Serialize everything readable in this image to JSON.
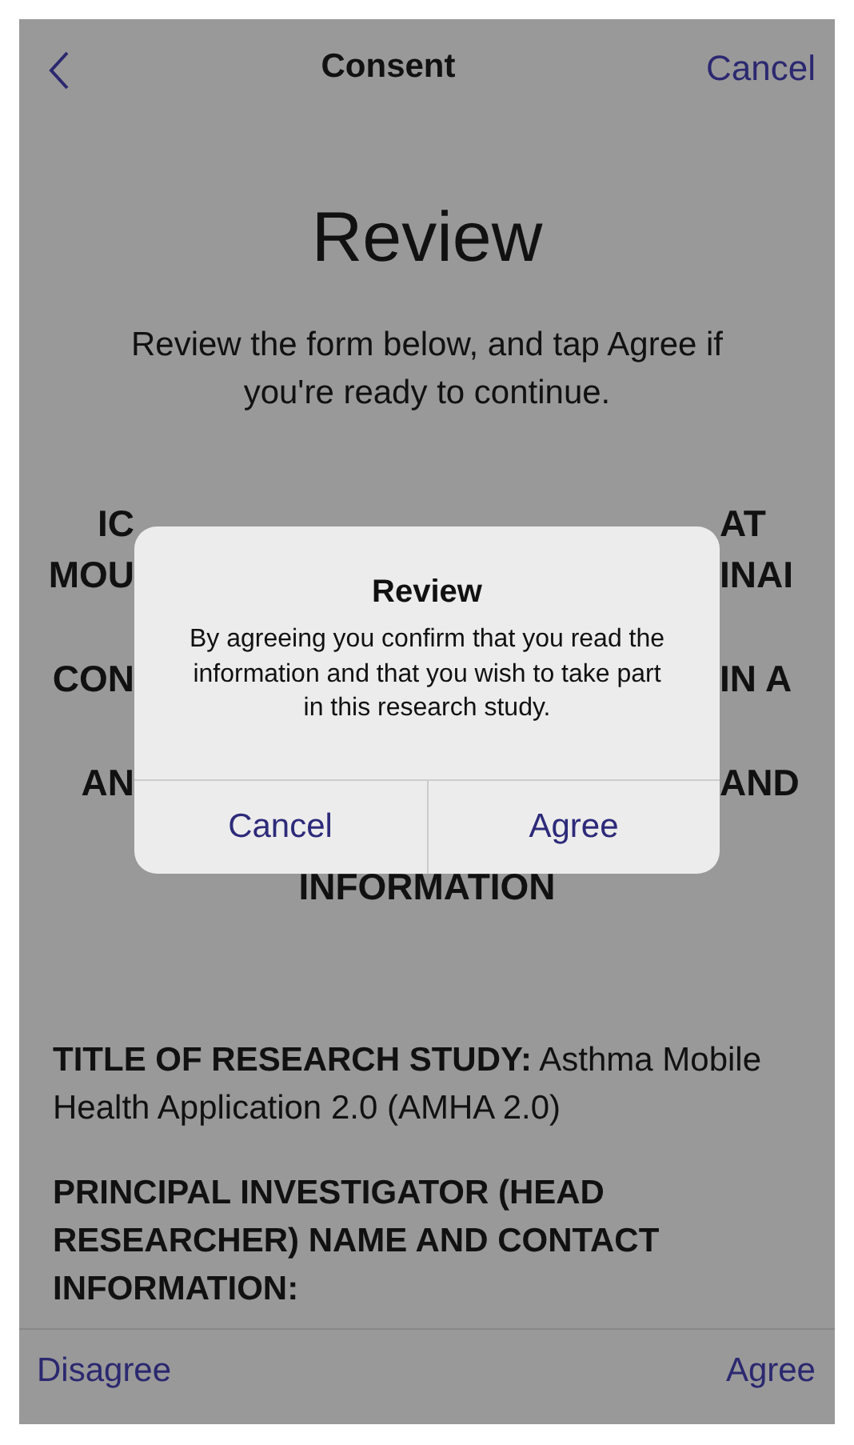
{
  "nav_bar": {
    "title": "Consent",
    "action": "Cancel"
  },
  "review": {
    "title": "Review",
    "subtitle": "Review the form below, and tap Agree if you're ready to continue."
  },
  "heading_lines": [
    {
      "left": "IC",
      "right": "AT"
    },
    {
      "left": "MOU",
      "right": "INAI"
    },
    {
      "left": "CON",
      "right": "IN A"
    },
    {
      "left": "AN",
      "right": "AND"
    },
    {
      "left": "INFORMATION"
    }
  ],
  "sections": [
    {
      "text": "**TITLE OF RESEARCH STUDY:** Asthma Mobile Health Application 2.0 (AMHA 2.0)"
    },
    {
      "text": "**PRINCIPAL INVESTIGATOR (HEAD RESEARCHER) NAME AND CONTACT INFORMATION:**"
    }
  ],
  "alert": {
    "title": "Review",
    "message": "By agreeing you confirm that you read the information and that you wish to take part in this research study.",
    "buttons": [
      "Cancel",
      "Agree"
    ]
  },
  "toolbar": {
    "left": "Disagree",
    "right": "Agree"
  }
}
